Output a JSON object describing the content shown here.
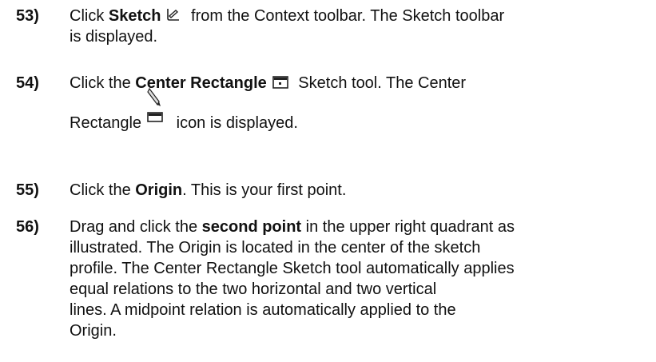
{
  "steps": [
    {
      "number": "53)",
      "lines": [
        {
          "pre": "Click ",
          "bold": "Sketch",
          "post": " from the Context toolbar. The Sketch toolbar"
        },
        {
          "text": "is displayed."
        }
      ],
      "icon": "sketch-icon"
    },
    {
      "number": "54)",
      "lines": [
        {
          "pre": "Click the ",
          "bold": "Center Rectangle",
          "post": " Sketch tool. The Center"
        },
        {
          "pre": "Rectangle",
          "post": " icon is displayed."
        }
      ],
      "icons": [
        "center-rectangle-icon",
        "center-rectangle-pencil-icon"
      ]
    },
    {
      "number": "55)",
      "lines": [
        {
          "pre": "Click the ",
          "bold": "Origin",
          "post": ". This is your first point."
        }
      ]
    },
    {
      "number": "56)",
      "lines": [
        {
          "pre": "Drag and click the ",
          "bold": "second point",
          "post": " in the upper right quadrant as"
        },
        {
          "text": "illustrated. The Origin is located in the center of the sketch"
        },
        {
          "text": "profile. The Center Rectangle Sketch tool automatically applies"
        },
        {
          "text": "equal relations to the two horizontal and two vertical"
        },
        {
          "text": "lines. A midpoint relation is automatically applied to the"
        },
        {
          "text": "Origin."
        }
      ]
    }
  ]
}
